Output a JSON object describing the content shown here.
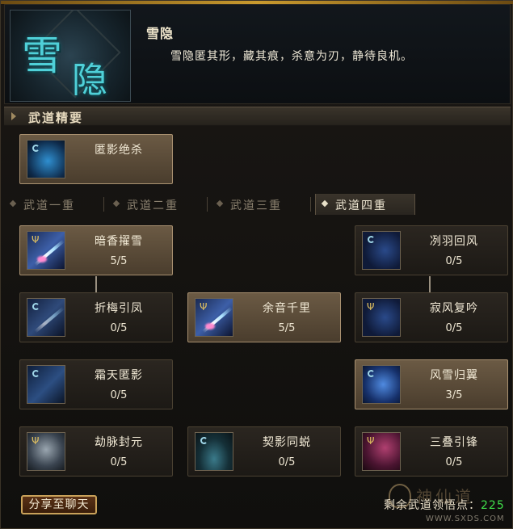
{
  "header": {
    "emblem_char_1": "雪",
    "emblem_char_2": "隐",
    "title": "雪隐",
    "description": "雪隐匿其形，藏其痕，杀意为刃，静待良机。"
  },
  "section": {
    "label": "武道精要"
  },
  "essence_skill": {
    "name": "匿影绝杀",
    "icon": "shadow-assassin-icon"
  },
  "tabs": [
    {
      "label": "武道一重",
      "active": false
    },
    {
      "label": "武道二重",
      "active": false
    },
    {
      "label": "武道三重",
      "active": false
    },
    {
      "label": "武道四重",
      "active": true
    }
  ],
  "skills": {
    "an_xiang_zhuo_xue": {
      "name": "暗香擢雪",
      "level": "5/5",
      "icon": "sword-streak-icon"
    },
    "lie_yu_hui_feng": {
      "name": "冽羽回风",
      "level": "0/5",
      "icon": "feather-wind-icon"
    },
    "zhe_mei_yin_feng": {
      "name": "折梅引凤",
      "level": "0/5",
      "icon": "sword-streak-icon"
    },
    "yu_yin_qian_li": {
      "name": "余音千里",
      "level": "5/5",
      "icon": "sword-streak-icon"
    },
    "ji_feng_fu_yin": {
      "name": "寂风复吟",
      "level": "0/5",
      "icon": "feather-wind-icon"
    },
    "shuang_tian_ni_ying": {
      "name": "霜天匿影",
      "level": "0/5",
      "icon": "frost-shadow-icon"
    },
    "feng_xue_gui_yi": {
      "name": "风雪归翼",
      "level": "3/5",
      "icon": "feather-wind-icon"
    },
    "jie_mai_feng_yuan": {
      "name": "劫脉封元",
      "level": "0/5",
      "icon": "sealed-meridian-icon"
    },
    "qi_ying_tong_shui": {
      "name": "契影同蜕",
      "level": "0/5",
      "icon": "shadow-vortex-icon"
    },
    "san_die_yin_feng": {
      "name": "三叠引锋",
      "level": "0/5",
      "icon": "blade-burst-icon"
    }
  },
  "footer": {
    "share_label": "分享至聊天",
    "points_label": "剩余武道领悟点：",
    "points_value": "225",
    "watermark_text": "神仙道",
    "watermark_url": "WWW.SXDS.COM"
  },
  "colors": {
    "accent_gold": "#c9a25a",
    "points_green": "#3fe04a",
    "emblem_teal": "#4fd0d8"
  }
}
